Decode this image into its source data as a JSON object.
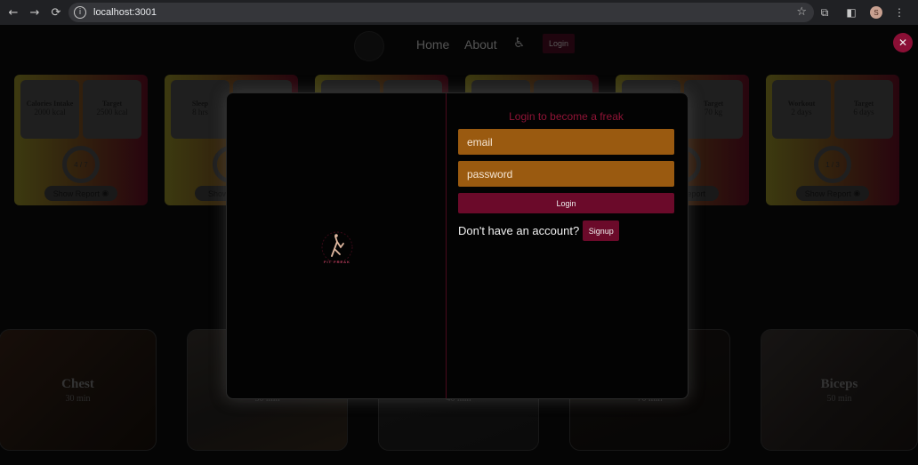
{
  "browser": {
    "url": "localhost:3001",
    "profile_initial": "S"
  },
  "navbar": {
    "home": "Home",
    "about": "About",
    "login": "Login"
  },
  "stat_cards": [
    {
      "left_label": "Calories Intake",
      "left_value": "2000 kcal",
      "right_label": "Target",
      "right_value": "2500 kcal",
      "progress": "4 / 7",
      "report": "Show Report"
    },
    {
      "left_label": "Sleep",
      "left_value": "8 hrs",
      "right_label": "",
      "right_value": "",
      "progress": "",
      "report": "Show Report"
    },
    {
      "left_label": "",
      "left_value": "",
      "right_label": "",
      "right_value": "",
      "progress": "",
      "report": ""
    },
    {
      "left_label": "",
      "left_value": "",
      "right_label": "",
      "right_value": "",
      "progress": "",
      "report": ""
    },
    {
      "left_label": "",
      "left_value": "",
      "right_label": "Target",
      "right_value": "70 kg",
      "progress": "",
      "report": "Show Report"
    },
    {
      "left_label": "Workout",
      "left_value": "2 days",
      "right_label": "Target",
      "right_value": "6 days",
      "progress": "1 / 3",
      "report": "Show Report"
    }
  ],
  "workouts": [
    {
      "name": "Chest",
      "duration": "30 min"
    },
    {
      "name": "",
      "duration": "30 min"
    },
    {
      "name": "",
      "duration": "40 min"
    },
    {
      "name": "",
      "duration": "70 min"
    },
    {
      "name": "Biceps",
      "duration": "50 min"
    }
  ],
  "modal": {
    "close": "✕",
    "logo_text": "FIT FREAK",
    "title": "Login to become a freak",
    "email_placeholder": "email",
    "password_placeholder": "password",
    "login_button": "Login",
    "signup_prompt": "Don't have an account?",
    "signup_button": "Signup"
  },
  "colors": {
    "accent": "#6b0a2a",
    "title": "#8f1436",
    "field": "#9a5a10",
    "close": "#8a0f35"
  }
}
